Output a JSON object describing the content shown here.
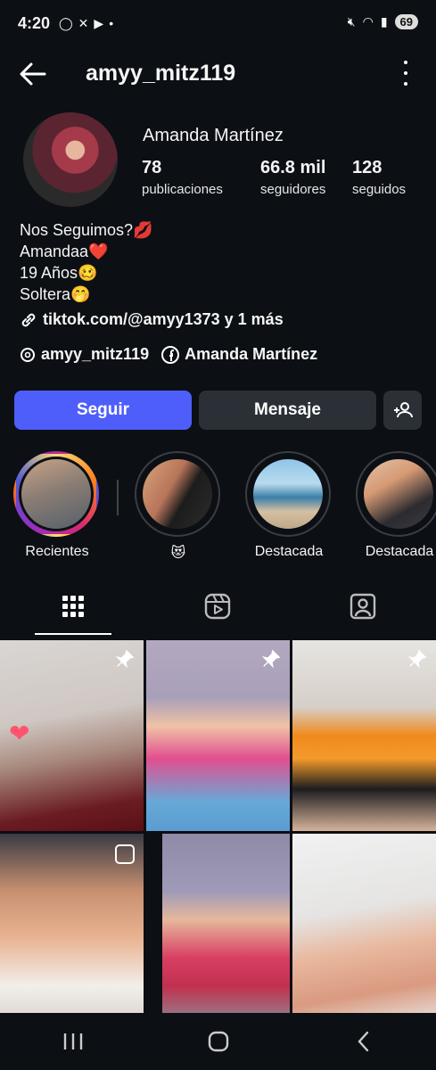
{
  "status_bar": {
    "time": "4:20",
    "battery": "69"
  },
  "header": {
    "username": "amyy_mitz119"
  },
  "profile": {
    "display_name": "Amanda  Martínez",
    "stats": [
      {
        "value": "78",
        "label": "publicaciones"
      },
      {
        "value": "66.8 mil",
        "label": "seguidores"
      },
      {
        "value": "128",
        "label": "seguidos"
      }
    ],
    "bio": [
      "Nos Seguimos?💋",
      "Amandaa❤️",
      "19 Años🥴",
      "Soltera🤭"
    ],
    "link": "tiktok.com/@amyy1373 y 1 más",
    "threads_handle": "amyy_mitz119",
    "facebook_name": "Amanda  Martínez"
  },
  "actions": {
    "follow": "Seguir",
    "message": "Mensaje"
  },
  "highlights": [
    {
      "label": "Recientes"
    },
    {
      "label": "😻"
    },
    {
      "label": "Destacada"
    },
    {
      "label": "Destacada"
    }
  ],
  "tabs": [
    "grid-icon",
    "reels-icon",
    "tagged-icon"
  ],
  "colors": {
    "accent": "#4e5efb",
    "background": "#0c0f14",
    "button_secondary": "#2b2f36"
  }
}
